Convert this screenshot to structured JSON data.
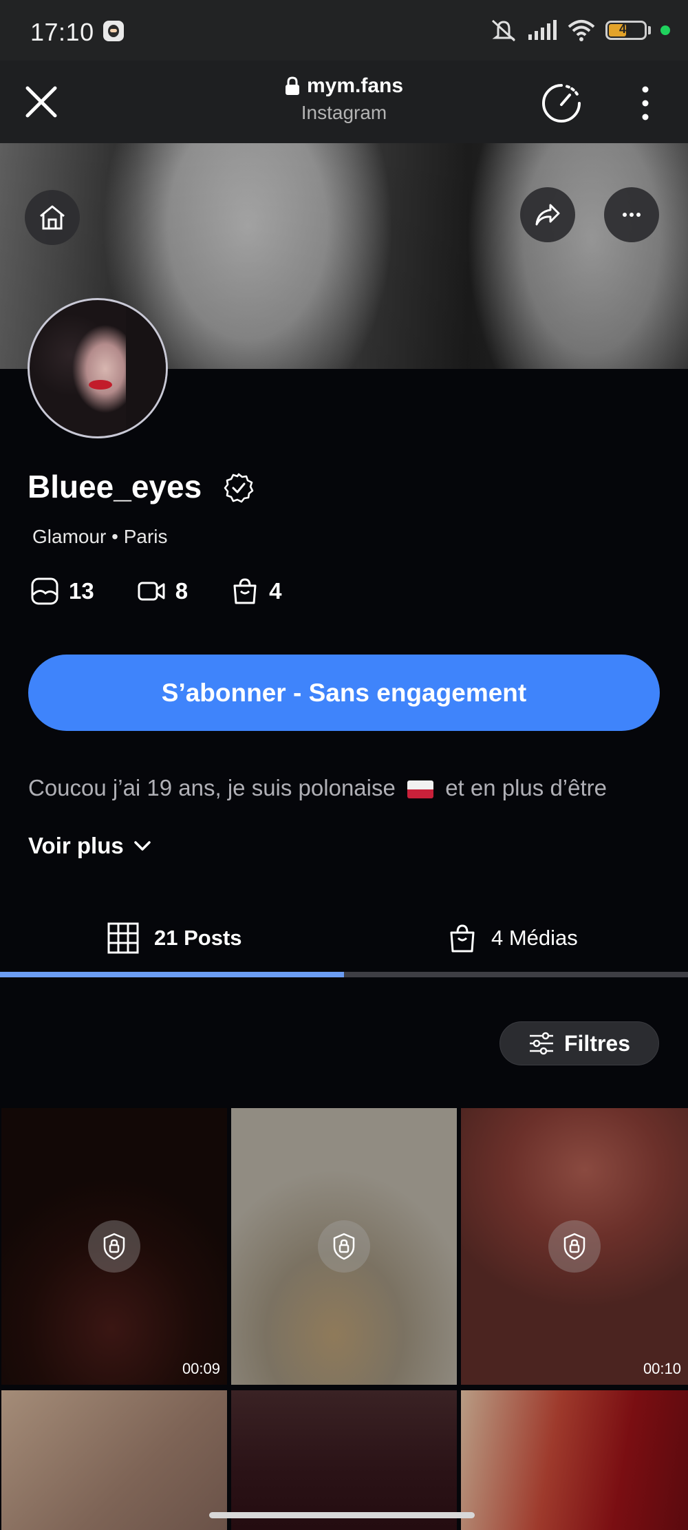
{
  "status_bar": {
    "time": "17:10",
    "battery": "49",
    "icons": [
      "mute-icon",
      "signal-icon",
      "wifi-icon",
      "battery-icon"
    ]
  },
  "browser": {
    "domain": "mym.fans",
    "subtitle": "Instagram"
  },
  "profile": {
    "username": "Bluee_eyes",
    "meta": "Glamour • Paris",
    "stats": {
      "photos": "13",
      "videos": "8",
      "shop": "4"
    },
    "subscribe_label": "S’abonner - Sans engagement",
    "bio_before_flag": "Coucou j’ai 19 ans, je suis polonaise",
    "bio_after_flag": "et en plus d’être",
    "see_more": "Voir plus"
  },
  "tabs": {
    "posts": "21 Posts",
    "medias": "4 Médias"
  },
  "filters_label": "Filtres",
  "grid": {
    "durations": [
      "00:09",
      "00:10"
    ]
  },
  "colors": {
    "accent": "#3f84fb",
    "background": "#05060a",
    "tab_indicator": "#6b9cf2"
  }
}
